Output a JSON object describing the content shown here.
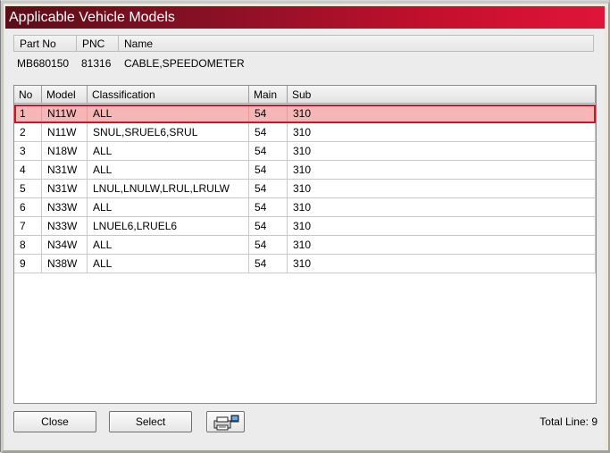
{
  "window": {
    "title": "Applicable Vehicle Models"
  },
  "part_info": {
    "headers": [
      "Part No",
      "PNC",
      "Name"
    ],
    "values": [
      "MB680150",
      "81316",
      "CABLE,SPEEDOMETER"
    ]
  },
  "grid": {
    "columns": [
      "No",
      "Model",
      "Classification",
      "Main",
      "Sub"
    ],
    "selected_row": 0,
    "rows": [
      [
        "1",
        "N11W",
        "ALL",
        "54",
        "310"
      ],
      [
        "2",
        "N11W",
        "SNUL,SRUEL6,SRUL",
        "54",
        "310"
      ],
      [
        "3",
        "N18W",
        "ALL",
        "54",
        "310"
      ],
      [
        "4",
        "N31W",
        "ALL",
        "54",
        "310"
      ],
      [
        "5",
        "N31W",
        "LNUL,LNULW,LRUL,LRULW",
        "54",
        "310"
      ],
      [
        "6",
        "N33W",
        "ALL",
        "54",
        "310"
      ],
      [
        "7",
        "N33W",
        "LNUEL6,LRUEL6",
        "54",
        "310"
      ],
      [
        "8",
        "N34W",
        "ALL",
        "54",
        "310"
      ],
      [
        "9",
        "N38W",
        "ALL",
        "54",
        "310"
      ]
    ]
  },
  "buttons": {
    "close": "Close",
    "select": "Select",
    "print_icon": "printer-icon"
  },
  "footer": {
    "total_line": "Total Line: 9"
  },
  "colors": {
    "title_start": "#5a0d18",
    "title_end": "#e0143a",
    "selection_fill": "#f6b6b6",
    "selection_border": "#c21a2c"
  }
}
